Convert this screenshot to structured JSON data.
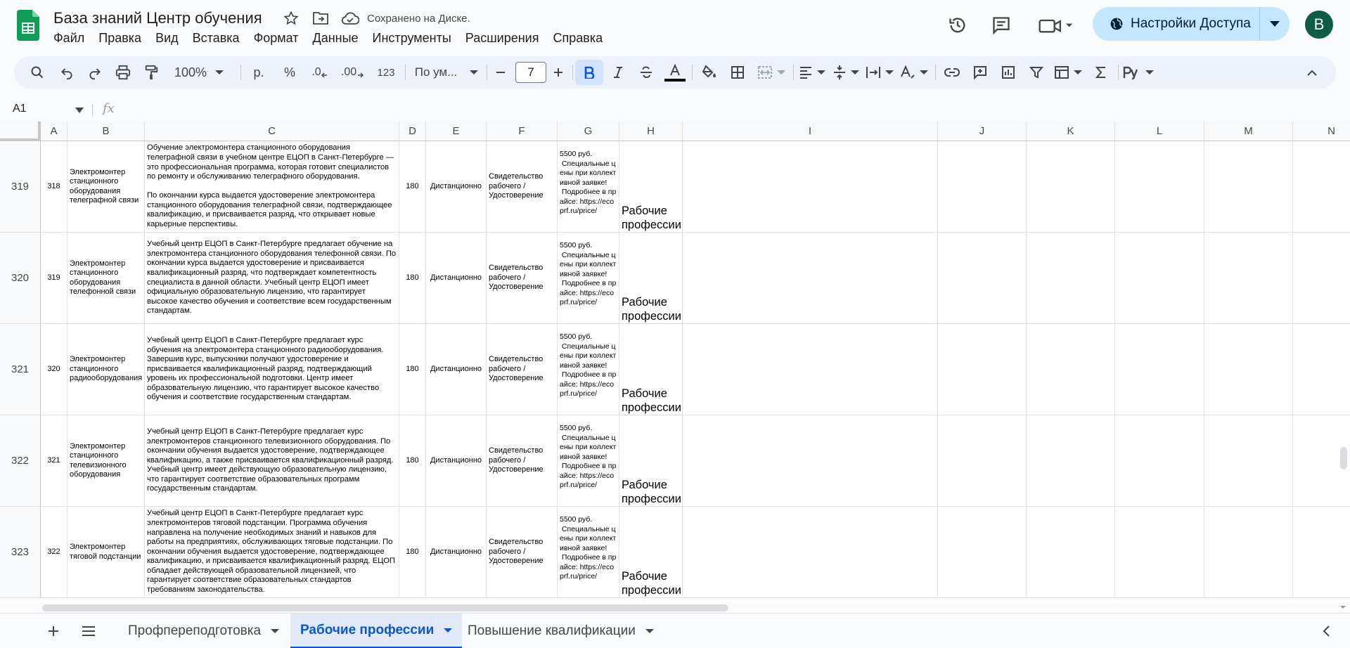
{
  "app": {
    "title": "База знаний Центр обучения",
    "saved_status": "Сохранено на Диске.",
    "share_label": "Настройки Доступа",
    "avatar_letter": "B",
    "brand_color": "#0f9d58"
  },
  "menu": [
    "Файл",
    "Правка",
    "Вид",
    "Вставка",
    "Формат",
    "Данные",
    "Инструменты",
    "Расширения",
    "Справка"
  ],
  "toolbar": {
    "zoom": "100%",
    "currency": "р.",
    "percent": "%",
    "dec_less": ".0",
    "dec_more": ".00",
    "number_format": "123",
    "font": "По ум...",
    "font_size": "7"
  },
  "formula_bar": {
    "name_box": "A1",
    "fx": "fx"
  },
  "columns": [
    "A",
    "B",
    "C",
    "D",
    "E",
    "F",
    "G",
    "H",
    "I",
    "J",
    "K",
    "L",
    "M",
    "N"
  ],
  "rows": [
    {
      "row_num": "319",
      "a": "318",
      "b": "Электромонтер станционного оборудования телеграфной связи",
      "c": "Обучение электромонтера станционного оборудования телеграфной связи в учебном центре ЕЦОП в Санкт-Петербурге — это профессиональная программа, которая готовит специалистов по ремонту и обслуживанию телеграфного оборудования.\n\nПо окончании курса выдается удостоверение электромонтера станционного оборудования телеграфной связи, подтверждающее квалификацию, и присваивается разряд, что открывает новые карьерные перспективы.",
      "d": "180",
      "e": "Дистанционно",
      "f": "Свидетельство рабочего / Удостоверение",
      "g": "5500 руб.\n Специальные цены при коллективной заявке!\n Подробнее в прайсе: https://ecoprf.ru/price/",
      "h": "Рабочие профессии"
    },
    {
      "row_num": "320",
      "a": "319",
      "b": "Электромонтер станционного оборудования телефонной связи",
      "c": "Учебный центр ЕЦОП в Санкт-Петербурге предлагает обучение на электромонтера станционного оборудования телефонной связи. По окончании курса выдается удостоверение и присваивается квалификационный разряд, что подтверждает компетентность специалиста в данной области. Учебный центр ЕЦОП имеет официальную образовательную лицензию, что гарантирует высокое качество обучения и соответствие всем государственным стандартам.",
      "d": "180",
      "e": "Дистанционно",
      "f": "Свидетельство рабочего / Удостоверение",
      "g": "5500 руб.\n Специальные цены при коллективной заявке!\n Подробнее в прайсе: https://ecoprf.ru/price/",
      "h": "Рабочие профессии"
    },
    {
      "row_num": "321",
      "a": "320",
      "b": "Электромонтер станционного радиооборудования",
      "c": "Учебный центр ЕЦОП в Санкт-Петербурге предлагает курс обучения на электромонтера станционного радиооборудования. Завершив курс, выпускники получают удостоверение и присваивается квалификационный разряд, подтверждающий уровень их профессиональной подготовки. Центр имеет образовательную лицензию, что гарантирует высокое качество обучения и соответствие государственным стандартам.",
      "d": "180",
      "e": "Дистанционно",
      "f": "Свидетельство рабочего / Удостоверение",
      "g": "5500 руб.\n Специальные цены при коллективной заявке!\n Подробнее в прайсе: https://ecoprf.ru/price/",
      "h": "Рабочие профессии"
    },
    {
      "row_num": "322",
      "a": "321",
      "b": "Электромонтер станционного телевизионного оборудования",
      "c": "Учебный центр ЕЦОП в Санкт-Петербурге предлагает курс электромонтеров станционного телевизионного оборудования. По окончании обучения выдается удостоверение, подтверждающее квалификацию, а также присваивается квалификационный разряд. Учебный центр имеет действующую образовательную лицензию, что гарантирует соответствие образовательных программ государственным стандартам.",
      "d": "180",
      "e": "Дистанционно",
      "f": "Свидетельство рабочего / Удостоверение",
      "g": "5500 руб.\n Специальные цены при коллективной заявке!\n Подробнее в прайсе: https://ecoprf.ru/price/",
      "h": "Рабочие профессии"
    },
    {
      "row_num": "323",
      "a": "322",
      "b": "Электромонтер тяговой подстанции",
      "c": "Учебный центр ЕЦОП в Санкт-Петербурге предлагает курс электромонтеров тяговой подстанции. Программа обучения направлена на получение необходимых знаний и навыков для работы на предприятиях, обслуживающих тяговые подстанции. По окончании обучения выдается удостоверение, подтверждающее квалификацию, и присваивается квалификационный разряд. ЕЦОП обладает действующей образовательной лицензией, что гарантирует соответствие образовательных стандартов требованиям законодательства.",
      "d": "180",
      "e": "Дистанционно",
      "f": "Свидетельство рабочего / Удостоверение",
      "g": "5500 руб.\n Специальные цены при коллективной заявке!\n Подробнее в прайсе: https://ecoprf.ru/price/",
      "h": "Рабочие профессии"
    }
  ],
  "sheets": [
    {
      "label": "Профпереподготовка",
      "active": false
    },
    {
      "label": "Рабочие профессии",
      "active": true
    },
    {
      "label": "Повышение квалификации",
      "active": false
    }
  ]
}
